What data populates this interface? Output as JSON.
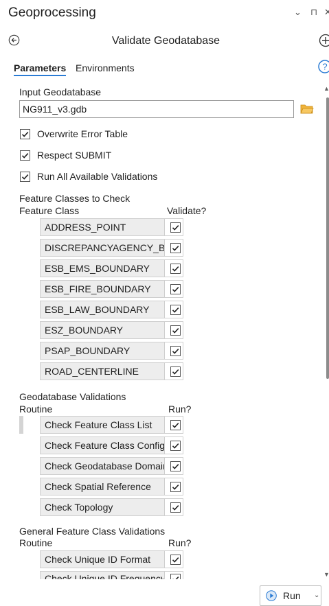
{
  "pane": {
    "title": "Geoprocessing",
    "controls": [
      "⌄",
      "⊓",
      "✕"
    ]
  },
  "tool": {
    "title": "Validate Geodatabase"
  },
  "tabs": [
    {
      "label": "Parameters",
      "active": true
    },
    {
      "label": "Environments",
      "active": false
    }
  ],
  "input_geodatabase": {
    "label": "Input Geodatabase",
    "value": "NG911_v3.gdb"
  },
  "options": [
    {
      "label": "Overwrite Error Table",
      "checked": true
    },
    {
      "label": "Respect SUBMIT",
      "checked": true
    },
    {
      "label": "Run All Available Validations",
      "checked": true
    }
  ],
  "feature_classes": {
    "section_label": "Feature Classes to Check",
    "col_name": "Feature Class",
    "col_check": "Validate?",
    "rows": [
      {
        "name": "ADDRESS_POINT",
        "checked": true
      },
      {
        "name": "DISCREPANCYAGENCY_BOUNDARY",
        "checked": true
      },
      {
        "name": "ESB_EMS_BOUNDARY",
        "checked": true
      },
      {
        "name": "ESB_FIRE_BOUNDARY",
        "checked": true
      },
      {
        "name": "ESB_LAW_BOUNDARY",
        "checked": true
      },
      {
        "name": "ESZ_BOUNDARY",
        "checked": true
      },
      {
        "name": "PSAP_BOUNDARY",
        "checked": true
      },
      {
        "name": "ROAD_CENTERLINE",
        "checked": true
      }
    ]
  },
  "gdb_validations": {
    "section_label": "Geodatabase Validations",
    "col_name": "Routine",
    "col_check": "Run?",
    "rows": [
      {
        "name": "Check Feature Class List",
        "checked": true
      },
      {
        "name": "Check Feature Class Configuration",
        "checked": true
      },
      {
        "name": "Check Geodatabase Domains",
        "checked": true
      },
      {
        "name": "Check Spatial Reference",
        "checked": true
      },
      {
        "name": "Check Topology",
        "checked": true
      }
    ]
  },
  "fc_validations": {
    "section_label": "General Feature Class Validations",
    "col_name": "Routine",
    "col_check": "Run?",
    "rows": [
      {
        "name": "Check Unique ID Format",
        "checked": true
      },
      {
        "name": "Check Unique ID Frequency",
        "checked": true
      }
    ]
  },
  "run_button": {
    "label": "Run"
  },
  "colors": {
    "accent": "#2a7bd4",
    "folder": "#e8a317",
    "cell_bg": "#ededed"
  }
}
